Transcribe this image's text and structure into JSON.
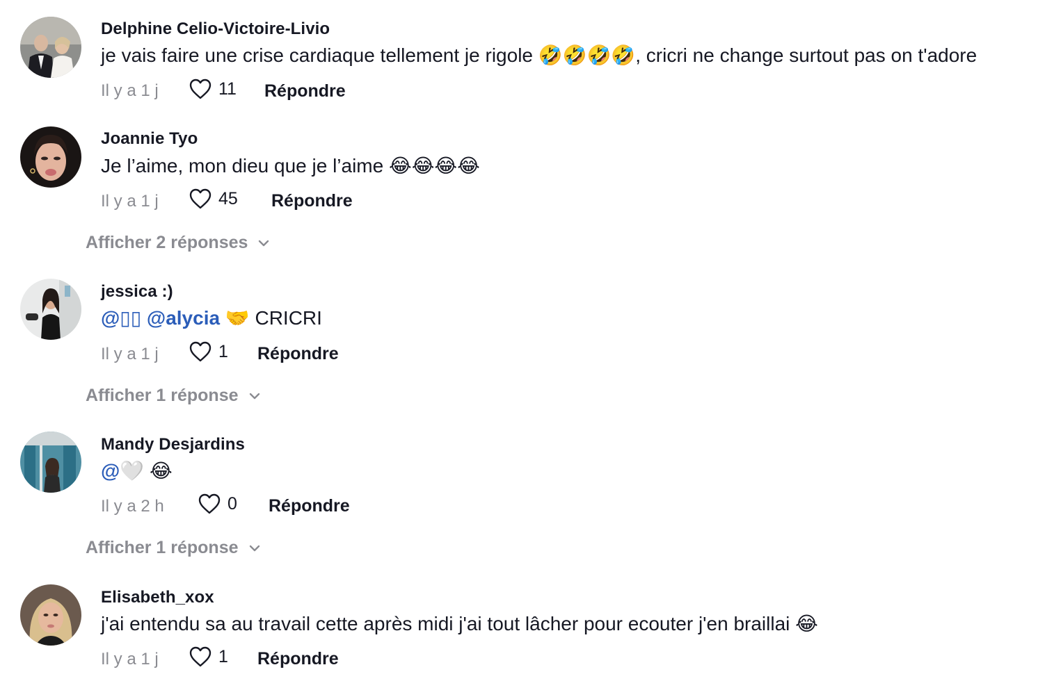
{
  "comments": [
    {
      "username": "Delphine Celio-Victoire-Livio",
      "text": "je vais faire une crise cardiaque tellement je rigole 🤣🤣🤣🤣, cricri ne change surtout pas on t'adore",
      "time": "Il y a 1 j",
      "likes": "11",
      "reply_label": "Répondre"
    },
    {
      "username": "Joannie Tyo",
      "text": "Je l’aime, mon dieu que je l’aime 😂😂😂😂",
      "time": "Il y a 1 j",
      "likes": "45",
      "reply_label": "Répondre",
      "view_replies": "Afficher 2 réponses"
    },
    {
      "username": "jessica :)",
      "mention_1": "@▯▯",
      "mention_2": "@alycia",
      "text_rest": "🤝 CRICRI",
      "time": "Il y a 1 j",
      "likes": "1",
      "reply_label": "Répondre",
      "view_replies": "Afficher 1 réponse"
    },
    {
      "username": "Mandy Desjardins",
      "mention_1": "@🤍",
      "text_rest": "😂",
      "time": "Il y a 2 h",
      "likes": "0",
      "reply_label": "Répondre",
      "view_replies": "Afficher 1 réponse"
    },
    {
      "username": "Elisabeth_xox",
      "text": "j'ai entendu sa au travail cette après midi j'ai tout lâcher pour ecouter j'en braillai 😂",
      "time": "Il y a 1 j",
      "likes": "1",
      "reply_label": "Répondre"
    }
  ],
  "icons": {
    "like": "heart-outline-icon",
    "expand": "chevron-down-icon"
  },
  "colors": {
    "text": "#161823",
    "muted": "#8a8b91",
    "mention": "#2b5db9",
    "background": "#ffffff"
  }
}
